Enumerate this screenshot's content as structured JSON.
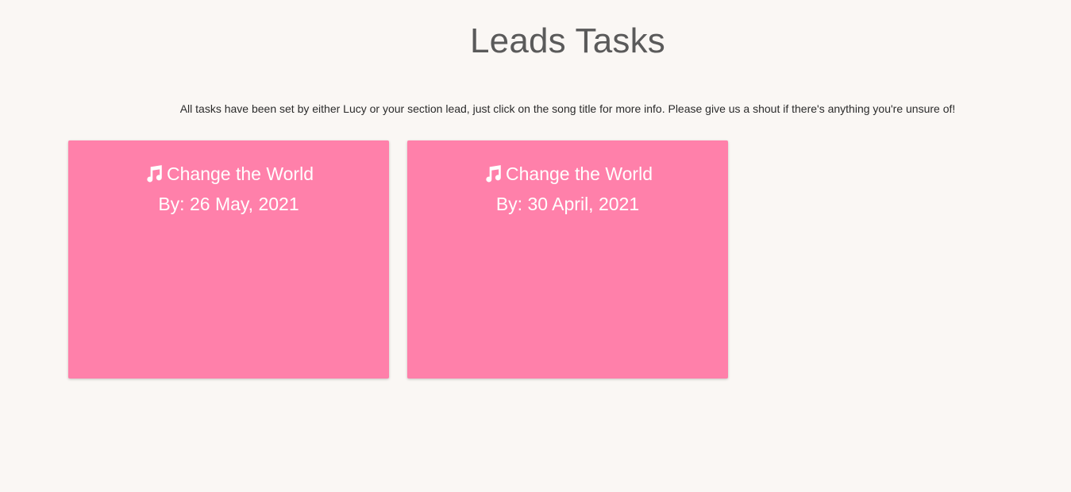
{
  "page": {
    "title": "Leads Tasks",
    "intro": "All tasks have been set by either Lucy or your section lead, just click on the song title for more info. Please give us a shout if there's anything you're unsure of!"
  },
  "colors": {
    "background": "#faf7f4",
    "card": "#ff80aa",
    "card_text": "#ffffff",
    "title_text": "#5a5a5a"
  },
  "tasks": [
    {
      "icon": "music-note-icon",
      "song_title": "Change the World",
      "due": "By: 26 May, 2021"
    },
    {
      "icon": "music-note-icon",
      "song_title": "Change the World",
      "due": "By: 30 April, 2021"
    }
  ]
}
